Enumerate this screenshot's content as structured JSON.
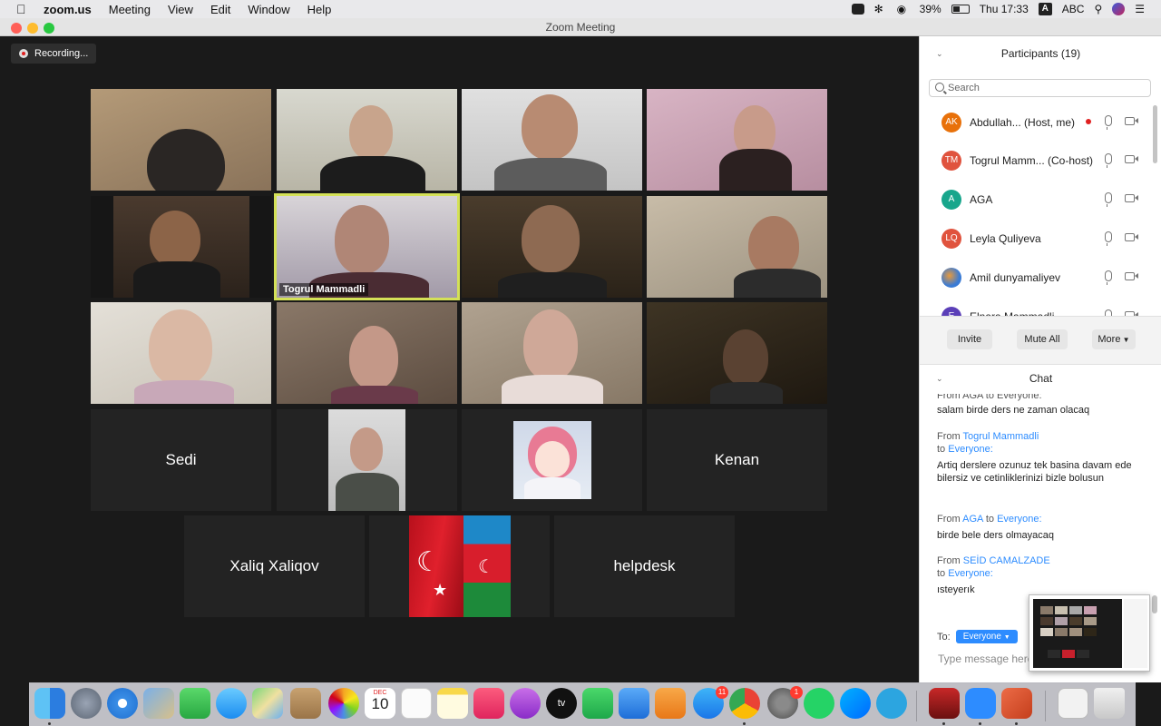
{
  "menubar": {
    "app_name": "zoom.us",
    "menus": [
      "Meeting",
      "View",
      "Edit",
      "Window",
      "Help"
    ],
    "battery": "39%",
    "clock": "Thu 17:33",
    "input_source": "ABC",
    "input_badge": "A"
  },
  "window": {
    "title": "Zoom Meeting"
  },
  "recording": {
    "label": "Recording..."
  },
  "video": {
    "active_speaker": "Togrul Mammadli",
    "name_tiles": [
      "Sedi",
      "Kenan",
      "Xaliq Xaliqov",
      "helpdesk"
    ]
  },
  "participants": {
    "header": "Participants (19)",
    "search_placeholder": "Search",
    "items": [
      {
        "initials": "AK",
        "name": "Abdullah...  (Host, me)",
        "color": "#e8710a"
      },
      {
        "initials": "TM",
        "name": "Togrul Mamm...  (Co-host)",
        "color": "#e0533e"
      },
      {
        "initials": "A",
        "name": "AGA",
        "color": "#18a68c"
      },
      {
        "initials": "LQ",
        "name": "Leyla Quliyeva",
        "color": "#e0533e"
      },
      {
        "initials": "",
        "name": "Amil dunyamaliyev",
        "color": "#3a7bd5"
      },
      {
        "initials": "E",
        "name": "Elnara Mammadli",
        "color": "#5b3fb8"
      }
    ],
    "buttons": {
      "invite": "Invite",
      "mute_all": "Mute All",
      "more": "More"
    }
  },
  "chat": {
    "header": "Chat",
    "partial_top": "From AGA to Everyone:",
    "messages": [
      {
        "from_label": "",
        "sender": "",
        "to_label": "",
        "recipient": "",
        "text": "salam birde ders ne zaman olacaq"
      },
      {
        "from_label": "From",
        "sender": "Togrul Mammadli",
        "to_label": "to",
        "recipient": "Everyone:",
        "text": "Artiq derslere ozunuz tek basina davam ede bilersiz ve cetinliklerinizi bizle bolusun"
      },
      {
        "from_label": "From",
        "sender": "AGA",
        "to_label": "to",
        "recipient": "Everyone:",
        "text": "birde bele ders olmayacaq"
      },
      {
        "from_label": "From",
        "sender": "SEİD CAMALZADE",
        "to_label": "to",
        "recipient": "Everyone:",
        "text": "ısteyerık"
      }
    ],
    "to_label": "To:",
    "to_value": "Everyone",
    "input_placeholder": "Type message here"
  },
  "dock": {
    "calendar_month": "DEC",
    "calendar_day": "10",
    "appstore_badge": "11",
    "prefs_badge": "1",
    "appletv_label": "tv"
  },
  "colors": {
    "accent": "#2d8cff",
    "active_border": "#d4e157",
    "recording_red": "#e02020"
  }
}
